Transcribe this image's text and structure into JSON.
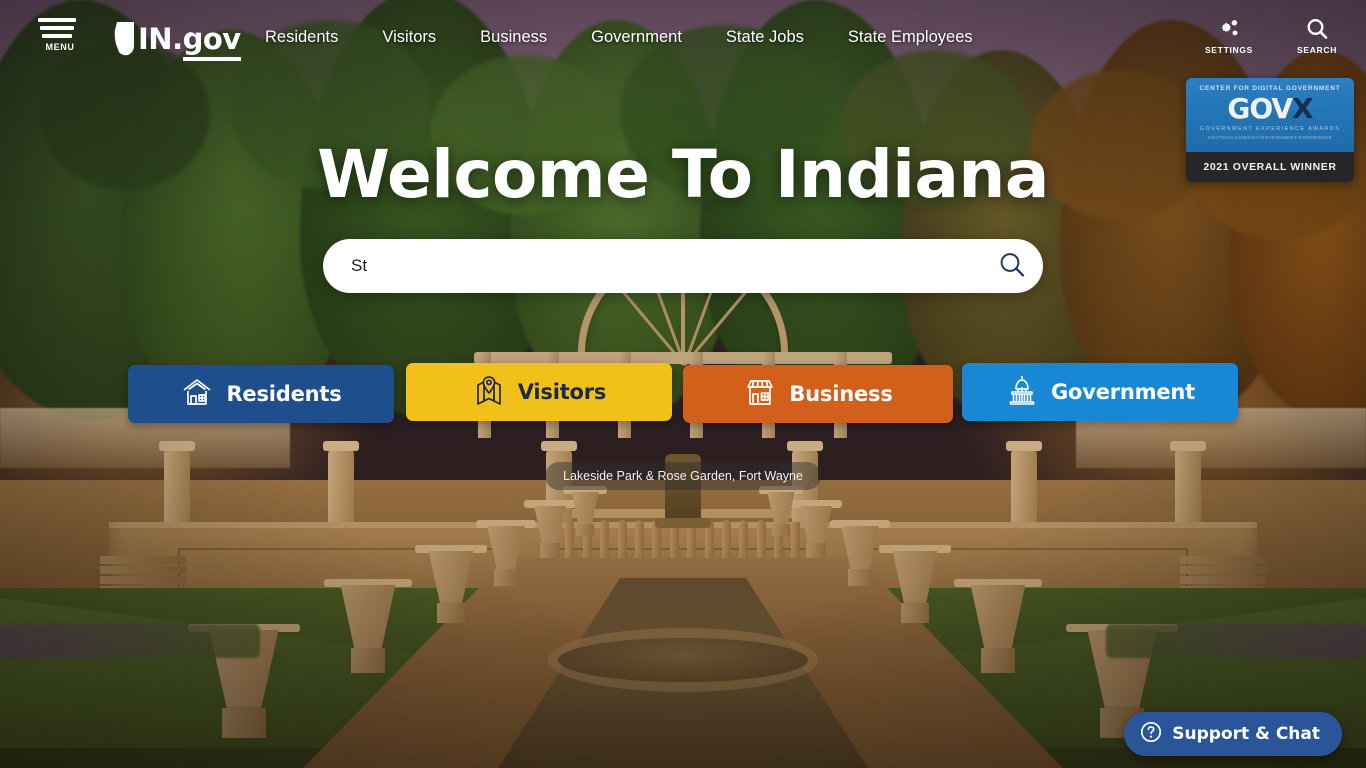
{
  "header": {
    "menu_label": "MENU",
    "logo": {
      "prefix": "IN",
      "dot": ".",
      "suffix": "gov",
      "icon": "indiana-state-outline-icon"
    },
    "nav_items": [
      {
        "label": "Residents"
      },
      {
        "label": "Visitors"
      },
      {
        "label": "Business"
      },
      {
        "label": "Government"
      },
      {
        "label": "State Jobs"
      },
      {
        "label": "State Employees"
      }
    ],
    "utilities": [
      {
        "label": "SETTINGS",
        "icon": "gears-icon"
      },
      {
        "label": "SEARCH",
        "icon": "search-icon"
      }
    ]
  },
  "award_badge": {
    "line1": "CENTER FOR DIGITAL GOVERNMENT",
    "logo_main": "GOV",
    "logo_mark": "X",
    "line3": "GOVERNMENT EXPERIENCE AWARDS",
    "line4": "GOVTECH.COM/GOV/GOVERNMENT-EXPERIENCE",
    "winner": "2021 OVERALL WINNER"
  },
  "hero": {
    "title": "Welcome To Indiana",
    "search": {
      "value": "St",
      "placeholder": "",
      "submit_icon": "search-icon"
    }
  },
  "quick_links": [
    {
      "label": "Residents",
      "icon": "house-icon",
      "color": "#1f4e8c",
      "text_color": "#ffffff"
    },
    {
      "label": "Visitors",
      "icon": "map-pin-icon",
      "color": "#f2c01b",
      "text_color": "#1b2a45"
    },
    {
      "label": "Business",
      "icon": "storefront-icon",
      "color": "#d2601a",
      "text_color": "#ffffff"
    },
    {
      "label": "Government",
      "icon": "capitol-dome-icon",
      "color": "#1887d4",
      "text_color": "#ffffff"
    }
  ],
  "photo_caption": "Lakeside Park & Rose Garden, Fort Wayne",
  "support_widget": {
    "label": "Support & Chat",
    "icon": "question-circle-icon"
  }
}
